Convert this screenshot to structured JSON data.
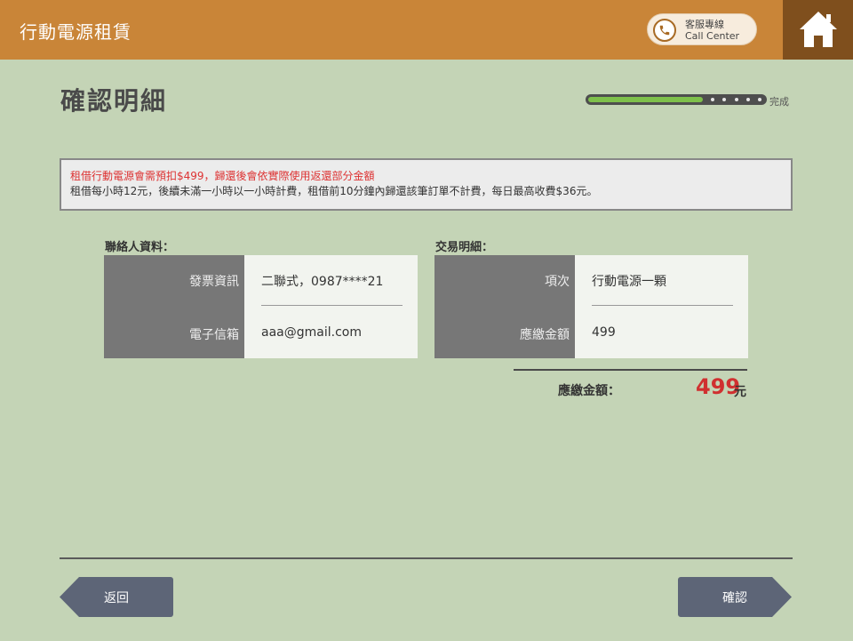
{
  "header": {
    "app_title": "行動電源租賃",
    "call_center": {
      "line1": "客服專線",
      "line2": "Call Center",
      "icon": "phone-icon"
    },
    "home_icon": "home-icon"
  },
  "page": {
    "title": "確認明細"
  },
  "progress": {
    "fraction": 0.65,
    "remaining_steps": 5,
    "label": "完成"
  },
  "notice": {
    "warning": "租借行動電源會需預扣$499，歸還後會依實際使用返還部分金額",
    "info": "租借每小時12元，後續未滿一小時以一小時計費，租借前10分鐘內歸還該筆訂單不計費，每日最高收費$36元。"
  },
  "contact": {
    "section_label": "聯絡人資料：",
    "rows": [
      {
        "label": "發票資訊",
        "value": "二聯式，0987****21"
      },
      {
        "label": "電子信箱",
        "value": "aaa@gmail.com"
      }
    ]
  },
  "transaction": {
    "section_label": "交易明細：",
    "rows": [
      {
        "label": "項次",
        "value": "行動電源一顆"
      },
      {
        "label": "應繳金額",
        "value": "499"
      }
    ]
  },
  "total": {
    "label": "應繳金額：",
    "amount": "499",
    "unit": "元"
  },
  "buttons": {
    "back": "返回",
    "confirm": "確認"
  },
  "colors": {
    "header": "#c98538",
    "home": "#7f4f1d",
    "background": "#c4d4b6",
    "accent_red": "#d03030",
    "progress_fill": "#7ec04b",
    "button": "#5d6577"
  }
}
